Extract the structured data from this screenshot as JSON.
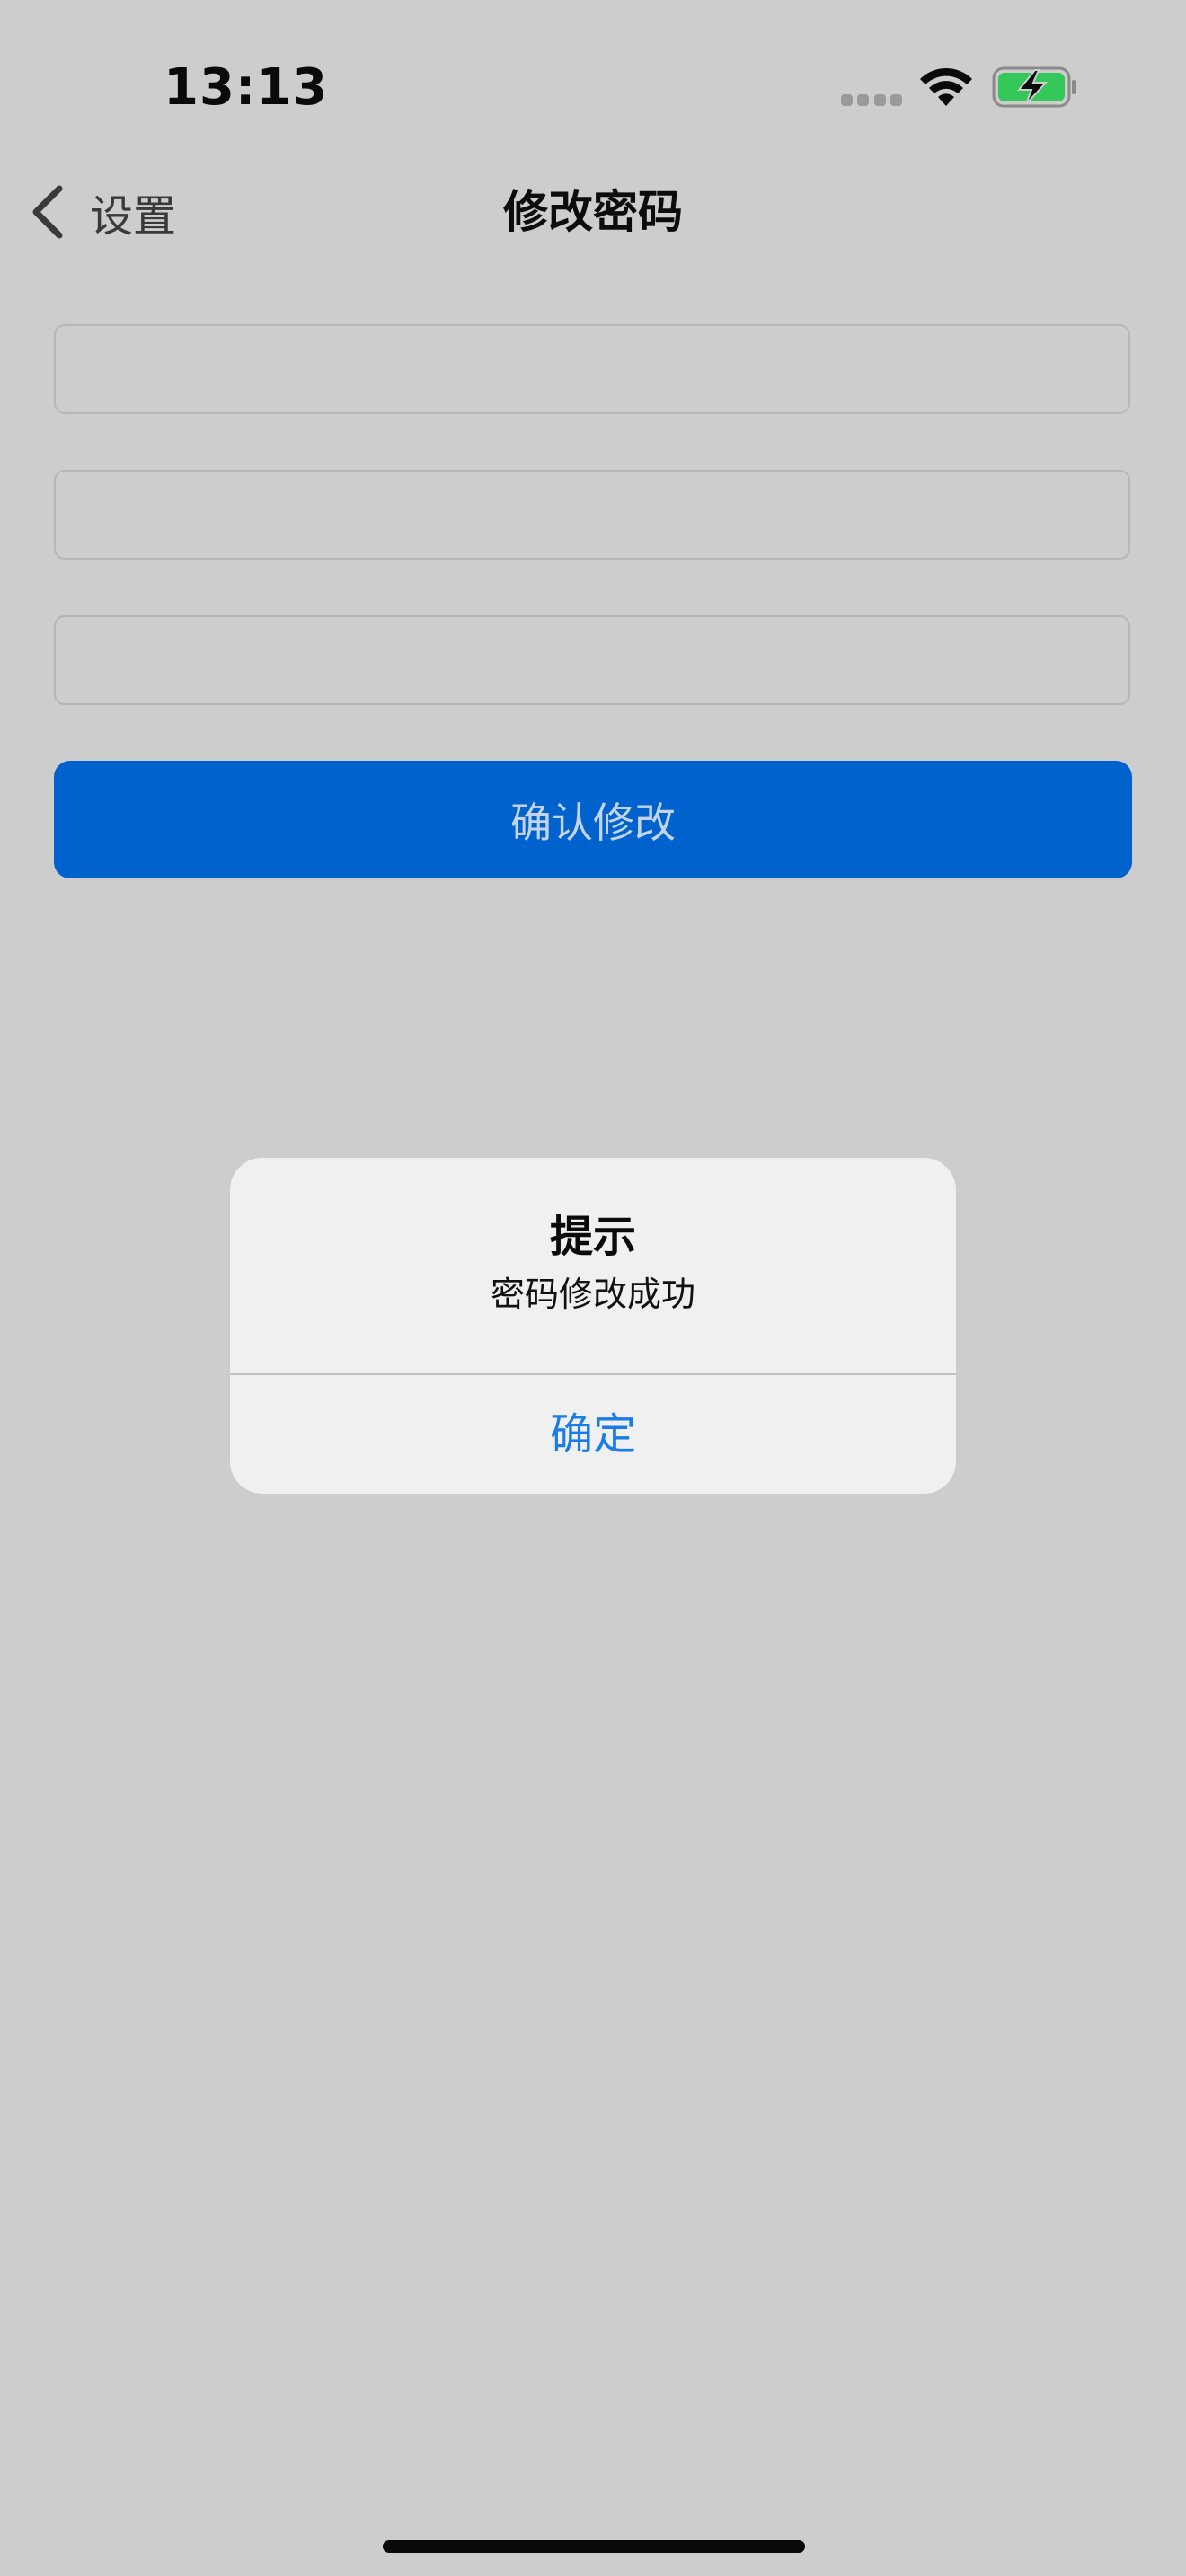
{
  "status_bar": {
    "time": "13:13",
    "icons": [
      "cellular-signal-icon",
      "wifi-icon",
      "battery-charging-icon"
    ],
    "battery_color": "#34c759"
  },
  "nav": {
    "back_label": "设置",
    "back_icon": "chevron-left-icon",
    "title": "修改密码"
  },
  "form": {
    "fields": [
      {
        "value": "",
        "placeholder": ""
      },
      {
        "value": "",
        "placeholder": ""
      },
      {
        "value": "",
        "placeholder": ""
      }
    ],
    "confirm_label": "确认修改",
    "confirm_color": "#0062cc"
  },
  "alert": {
    "title": "提示",
    "message": "密码修改成功",
    "ok_label": "确定",
    "ok_color": "#1a7ce6"
  }
}
